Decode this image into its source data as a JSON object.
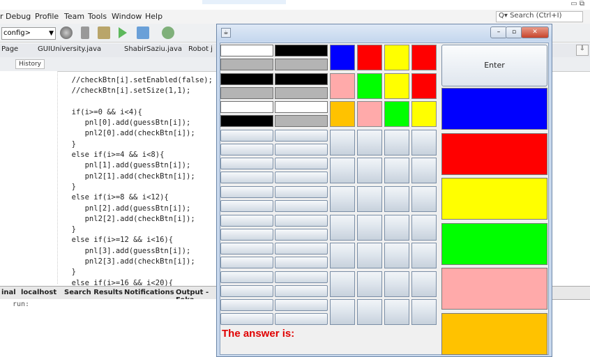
{
  "ide": {
    "menu": [
      "Debug",
      "Profile",
      "Team",
      "Tools",
      "Window",
      "Help"
    ],
    "menu_prefix": "r",
    "search_placeholder": "Search (Ctrl+I)",
    "config_value": "config>",
    "file_tabs": [
      "Page",
      "GUIUniversity.java",
      "ShabirSaziu.java",
      "Robot j"
    ],
    "history_label": "History",
    "code_lines": [
      "  //checkBtn[i].setEnabled(false);",
      "  //checkBtn[i].setSize(1,1);",
      "",
      "  if(i>=0 && i<4){",
      "     pnl[0].add(guessBtn[i]);",
      "     pnl2[0].add(checkBtn[i]);",
      "  }",
      "  else if(i>=4 && i<8){",
      "     pnl[1].add(guessBtn[i]);",
      "     pnl2[1].add(checkBtn[i]);",
      "  }",
      "  else if(i>=8 && i<12){",
      "     pnl[2].add(guessBtn[i]);",
      "     pnl2[2].add(checkBtn[i]);",
      "  }",
      "  else if(i>=12 && i<16){",
      "     pnl[3].add(guessBtn[i]);",
      "     pnl2[3].add(checkBtn[i]);",
      "  }",
      "  else if(i>=16 && i<20){",
      "     pnl[4].add(guessBtn[i]);",
      "     pnl2[4].add(checkBtn[i]);"
    ],
    "bottom_tabs": [
      "inal",
      "localhost",
      "Search Results",
      "Notifications",
      "Output - Feka"
    ],
    "output_text": "run:"
  },
  "game": {
    "enter_label": "Enter",
    "answer_label": "The answer is:",
    "colors": {
      "blue": "#0000ff",
      "red": "#ff0000",
      "yellow": "#ffff00",
      "green": "#00ff00",
      "pink": "#ffaaaa",
      "orange": "#ffc200",
      "black": "#000000",
      "white": "#ffffff",
      "gray": "#b4b4b4"
    },
    "palette": [
      "blue",
      "red",
      "yellow",
      "green",
      "pink",
      "orange"
    ],
    "guess_rows": [
      [
        "blue",
        "red",
        "yellow",
        "red"
      ],
      [
        "pink",
        "green",
        "yellow",
        "red"
      ],
      [
        "orange",
        "pink",
        "green",
        "yellow"
      ]
    ],
    "feedback_rows": [
      [
        "white",
        "black",
        "gray",
        "gray"
      ],
      [
        "black",
        "black",
        "gray",
        "gray"
      ],
      [
        "white",
        "white",
        "black",
        "gray"
      ]
    ],
    "total_rows": 10
  }
}
